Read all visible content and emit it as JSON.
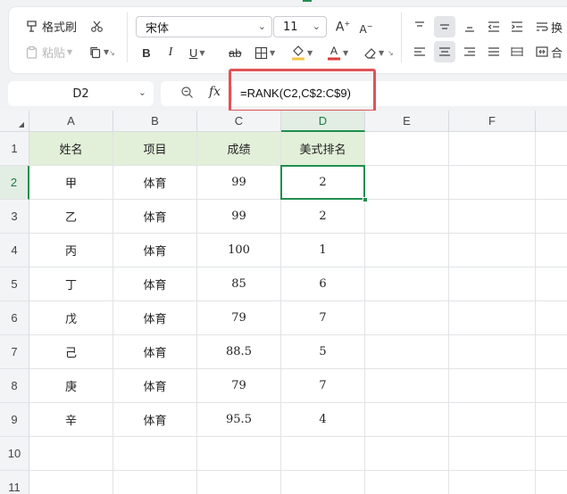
{
  "ribbon": {
    "format_painter": "格式刷",
    "paste": "粘贴",
    "font_name": "宋体",
    "font_size": "11",
    "bold": "B",
    "italic": "I",
    "underline": "U",
    "strikethrough": "ab",
    "wrap_text": "换",
    "merge": "合",
    "font_color_hex": "#e03a3a",
    "fill_color_hex": "#f4c542"
  },
  "formula_bar": {
    "cell_ref": "D2",
    "fx_label": "fx",
    "formula": "=RANK(C2,C$2:C$9)"
  },
  "sheet": {
    "columns": [
      "A",
      "B",
      "C",
      "D",
      "E",
      "F"
    ],
    "rows": [
      "1",
      "2",
      "3",
      "4",
      "5",
      "6",
      "7",
      "8",
      "9",
      "10",
      "11"
    ],
    "header": [
      "姓名",
      "项目",
      "成绩",
      "美式排名"
    ],
    "data": [
      [
        "甲",
        "体育",
        "99",
        "2"
      ],
      [
        "乙",
        "体育",
        "99",
        "2"
      ],
      [
        "丙",
        "体育",
        "100",
        "1"
      ],
      [
        "丁",
        "体育",
        "85",
        "6"
      ],
      [
        "戊",
        "体育",
        "79",
        "7"
      ],
      [
        "己",
        "体育",
        "88.5",
        "5"
      ],
      [
        "庚",
        "体育",
        "79",
        "7"
      ],
      [
        "辛",
        "体育",
        "95.5",
        "4"
      ]
    ],
    "active_cell": "D2",
    "header_fill_hex": "#e2efd9",
    "selection_color_hex": "#1f8f4e",
    "highlight_border_hex": "#e05356"
  }
}
